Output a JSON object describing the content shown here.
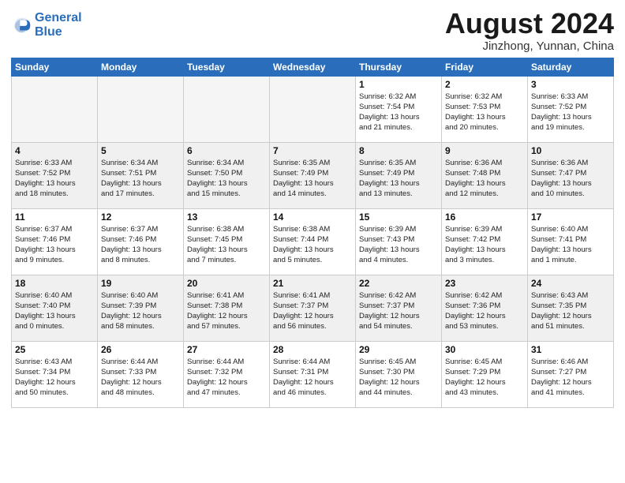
{
  "logo": {
    "line1": "General",
    "line2": "Blue"
  },
  "title": "August 2024",
  "subtitle": "Jinzhong, Yunnan, China",
  "weekdays": [
    "Sunday",
    "Monday",
    "Tuesday",
    "Wednesday",
    "Thursday",
    "Friday",
    "Saturday"
  ],
  "weeks": [
    [
      {
        "day": "",
        "detail": "",
        "empty": true
      },
      {
        "day": "",
        "detail": "",
        "empty": true
      },
      {
        "day": "",
        "detail": "",
        "empty": true
      },
      {
        "day": "",
        "detail": "",
        "empty": true
      },
      {
        "day": "1",
        "detail": "Sunrise: 6:32 AM\nSunset: 7:54 PM\nDaylight: 13 hours\nand 21 minutes."
      },
      {
        "day": "2",
        "detail": "Sunrise: 6:32 AM\nSunset: 7:53 PM\nDaylight: 13 hours\nand 20 minutes."
      },
      {
        "day": "3",
        "detail": "Sunrise: 6:33 AM\nSunset: 7:52 PM\nDaylight: 13 hours\nand 19 minutes."
      }
    ],
    [
      {
        "day": "4",
        "detail": "Sunrise: 6:33 AM\nSunset: 7:52 PM\nDaylight: 13 hours\nand 18 minutes."
      },
      {
        "day": "5",
        "detail": "Sunrise: 6:34 AM\nSunset: 7:51 PM\nDaylight: 13 hours\nand 17 minutes."
      },
      {
        "day": "6",
        "detail": "Sunrise: 6:34 AM\nSunset: 7:50 PM\nDaylight: 13 hours\nand 15 minutes."
      },
      {
        "day": "7",
        "detail": "Sunrise: 6:35 AM\nSunset: 7:49 PM\nDaylight: 13 hours\nand 14 minutes."
      },
      {
        "day": "8",
        "detail": "Sunrise: 6:35 AM\nSunset: 7:49 PM\nDaylight: 13 hours\nand 13 minutes."
      },
      {
        "day": "9",
        "detail": "Sunrise: 6:36 AM\nSunset: 7:48 PM\nDaylight: 13 hours\nand 12 minutes."
      },
      {
        "day": "10",
        "detail": "Sunrise: 6:36 AM\nSunset: 7:47 PM\nDaylight: 13 hours\nand 10 minutes."
      }
    ],
    [
      {
        "day": "11",
        "detail": "Sunrise: 6:37 AM\nSunset: 7:46 PM\nDaylight: 13 hours\nand 9 minutes."
      },
      {
        "day": "12",
        "detail": "Sunrise: 6:37 AM\nSunset: 7:46 PM\nDaylight: 13 hours\nand 8 minutes."
      },
      {
        "day": "13",
        "detail": "Sunrise: 6:38 AM\nSunset: 7:45 PM\nDaylight: 13 hours\nand 7 minutes."
      },
      {
        "day": "14",
        "detail": "Sunrise: 6:38 AM\nSunset: 7:44 PM\nDaylight: 13 hours\nand 5 minutes."
      },
      {
        "day": "15",
        "detail": "Sunrise: 6:39 AM\nSunset: 7:43 PM\nDaylight: 13 hours\nand 4 minutes."
      },
      {
        "day": "16",
        "detail": "Sunrise: 6:39 AM\nSunset: 7:42 PM\nDaylight: 13 hours\nand 3 minutes."
      },
      {
        "day": "17",
        "detail": "Sunrise: 6:40 AM\nSunset: 7:41 PM\nDaylight: 13 hours\nand 1 minute."
      }
    ],
    [
      {
        "day": "18",
        "detail": "Sunrise: 6:40 AM\nSunset: 7:40 PM\nDaylight: 13 hours\nand 0 minutes."
      },
      {
        "day": "19",
        "detail": "Sunrise: 6:40 AM\nSunset: 7:39 PM\nDaylight: 12 hours\nand 58 minutes."
      },
      {
        "day": "20",
        "detail": "Sunrise: 6:41 AM\nSunset: 7:38 PM\nDaylight: 12 hours\nand 57 minutes."
      },
      {
        "day": "21",
        "detail": "Sunrise: 6:41 AM\nSunset: 7:37 PM\nDaylight: 12 hours\nand 56 minutes."
      },
      {
        "day": "22",
        "detail": "Sunrise: 6:42 AM\nSunset: 7:37 PM\nDaylight: 12 hours\nand 54 minutes."
      },
      {
        "day": "23",
        "detail": "Sunrise: 6:42 AM\nSunset: 7:36 PM\nDaylight: 12 hours\nand 53 minutes."
      },
      {
        "day": "24",
        "detail": "Sunrise: 6:43 AM\nSunset: 7:35 PM\nDaylight: 12 hours\nand 51 minutes."
      }
    ],
    [
      {
        "day": "25",
        "detail": "Sunrise: 6:43 AM\nSunset: 7:34 PM\nDaylight: 12 hours\nand 50 minutes."
      },
      {
        "day": "26",
        "detail": "Sunrise: 6:44 AM\nSunset: 7:33 PM\nDaylight: 12 hours\nand 48 minutes."
      },
      {
        "day": "27",
        "detail": "Sunrise: 6:44 AM\nSunset: 7:32 PM\nDaylight: 12 hours\nand 47 minutes."
      },
      {
        "day": "28",
        "detail": "Sunrise: 6:44 AM\nSunset: 7:31 PM\nDaylight: 12 hours\nand 46 minutes."
      },
      {
        "day": "29",
        "detail": "Sunrise: 6:45 AM\nSunset: 7:30 PM\nDaylight: 12 hours\nand 44 minutes."
      },
      {
        "day": "30",
        "detail": "Sunrise: 6:45 AM\nSunset: 7:29 PM\nDaylight: 12 hours\nand 43 minutes."
      },
      {
        "day": "31",
        "detail": "Sunrise: 6:46 AM\nSunset: 7:27 PM\nDaylight: 12 hours\nand 41 minutes."
      }
    ]
  ]
}
